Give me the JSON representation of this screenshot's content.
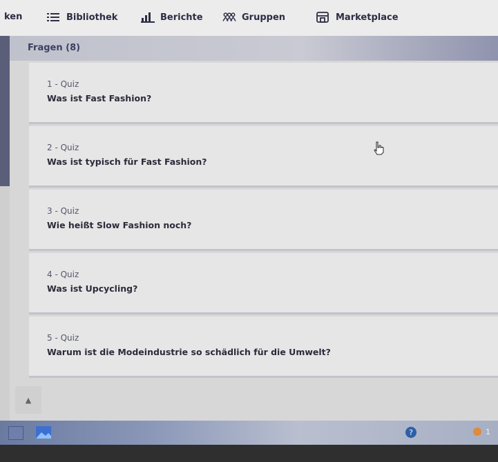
{
  "nav": {
    "partial_label": "ken",
    "items": [
      {
        "label": "Bibliothek",
        "icon": "list-icon"
      },
      {
        "label": "Berichte",
        "icon": "bar-chart-icon"
      },
      {
        "label": "Gruppen",
        "icon": "group-icon"
      },
      {
        "label": "Marketplace",
        "icon": "store-icon"
      }
    ]
  },
  "section": {
    "title": "Fragen (8)"
  },
  "questions": [
    {
      "number": "1 - Quiz",
      "text": "Was ist Fast Fashion?"
    },
    {
      "number": "2 - Quiz",
      "text": "Was ist typisch für Fast Fashion?"
    },
    {
      "number": "3 - Quiz",
      "text": "Wie heißt Slow Fashion noch?"
    },
    {
      "number": "4 - Quiz",
      "text": "Was ist Upcycling?"
    },
    {
      "number": "5 - Quiz",
      "text": "Warum ist die Modeindustrie so schädlich für die Umwelt?"
    }
  ],
  "taskbar": {
    "clock_partial": "1"
  },
  "colors": {
    "header_text": "#3d3f63",
    "nav_text": "#2c2c44",
    "sidebar": "#5a5e78"
  }
}
